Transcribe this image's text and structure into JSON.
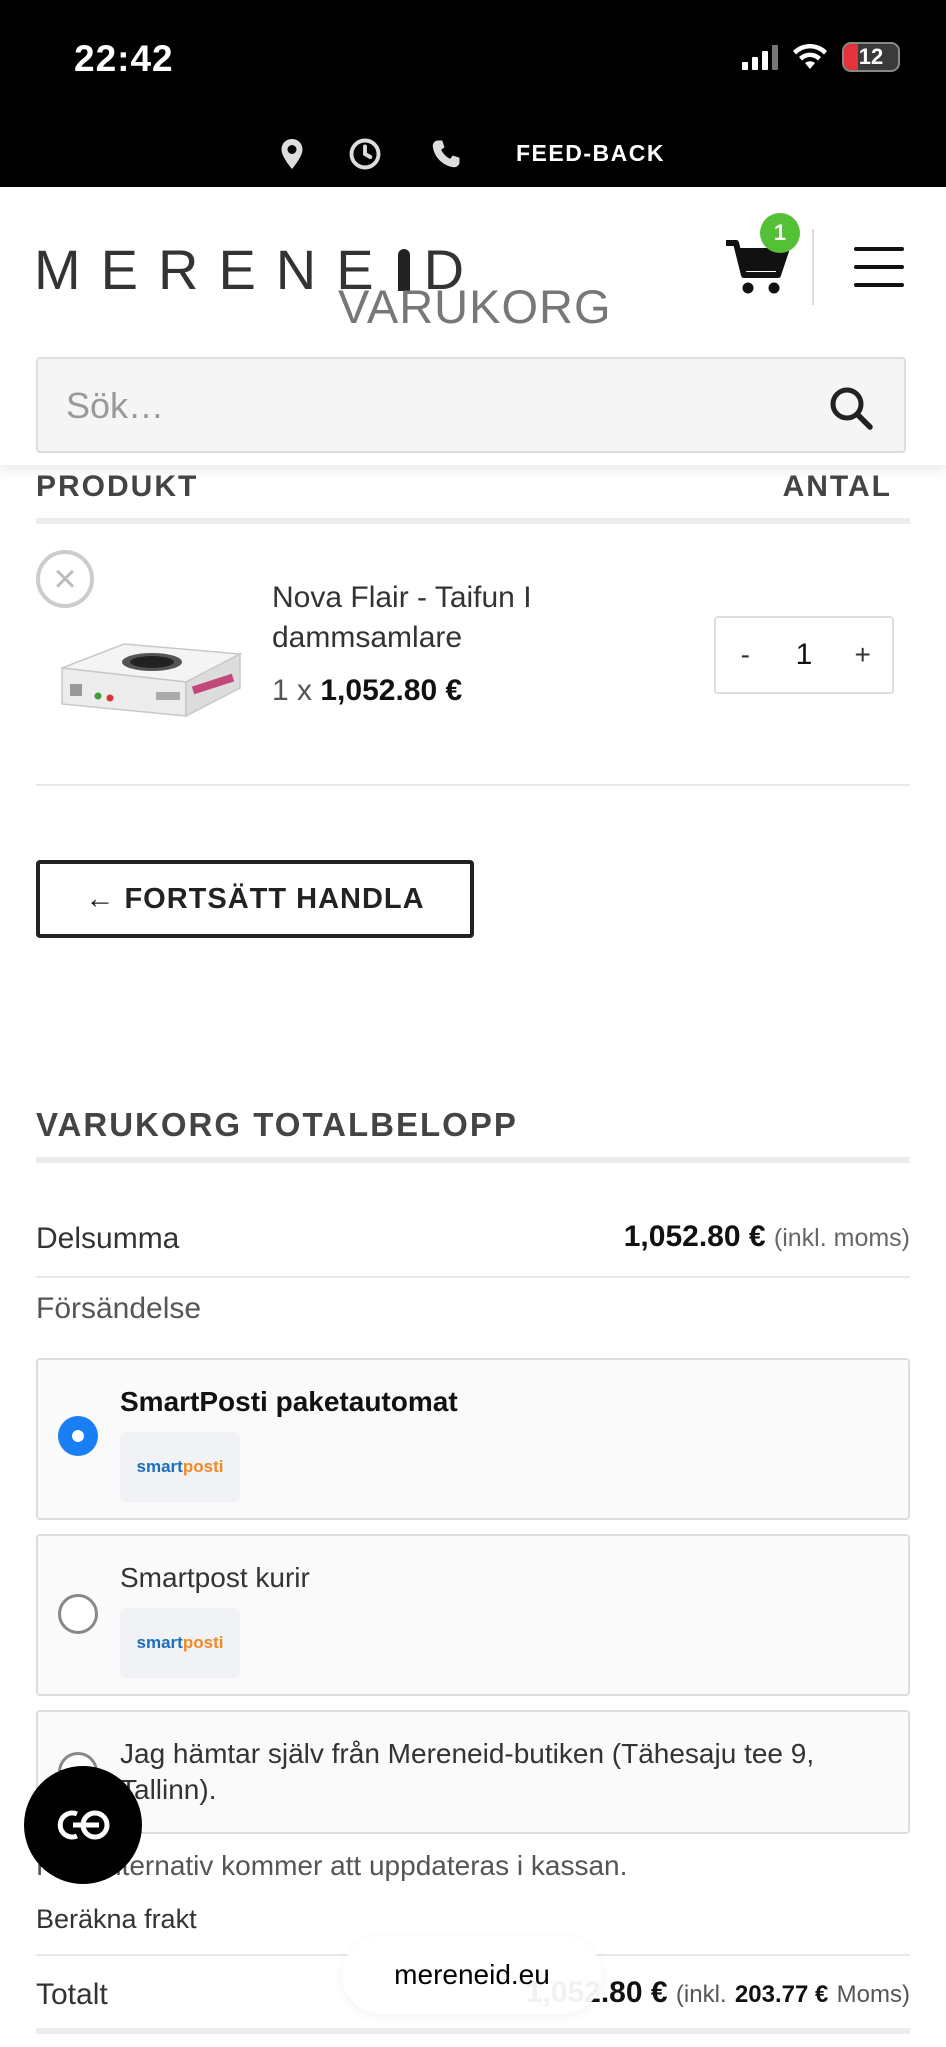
{
  "status_bar": {
    "time": "22:42",
    "battery": "12"
  },
  "info_bar": {
    "feedback": "FEED-BACK"
  },
  "header": {
    "logo": {
      "left": "MERENE",
      "right": "D"
    },
    "page_title": "VARUKORG",
    "cart_count": "1",
    "search_placeholder": "Sök…"
  },
  "cart_table": {
    "col_product": "PRODUKT",
    "col_quantity": "ANTAL",
    "items": [
      {
        "name": "Nova Flair - Taifun I dammsamlare",
        "qty_prefix": "1 x",
        "price": "1,052.80 €",
        "quantity": "1",
        "minus": "-",
        "plus": "+"
      }
    ]
  },
  "continue_label": "← FORTSÄTT HANDLA",
  "totals": {
    "title": "VARUKORG TOTALBELOPP",
    "subtotal_label": "Delsumma",
    "subtotal_value": "1,052.80 €",
    "subtotal_note": "(inkl. moms)",
    "shipping_label": "Försändelse",
    "shipping_options": [
      {
        "title": "SmartPosti paketautomat",
        "selected": true,
        "logo_a": "smart",
        "logo_b": "posti"
      },
      {
        "title": "Smartpost kurir",
        "selected": false,
        "logo_a": "smart",
        "logo_b": "posti"
      },
      {
        "title": "Jag hämtar själv från Mereneid-butiken (Tähesaju tee 9, Tallinn).",
        "selected": false
      }
    ],
    "shipping_note": "Fraktalternativ kommer att uppdateras i kassan.",
    "calc_shipping": "Beräkna frakt",
    "total_label": "Totalt",
    "total_value": "1,052.80 €",
    "total_inkl": "(inkl.",
    "total_tax": "203.77 €",
    "total_tax_label": "Moms)"
  },
  "browser": {
    "url": "mereneid.eu"
  },
  "colors": {
    "accent": "#1a7ef5",
    "badge": "#53c036",
    "battery": "#e5333b"
  }
}
